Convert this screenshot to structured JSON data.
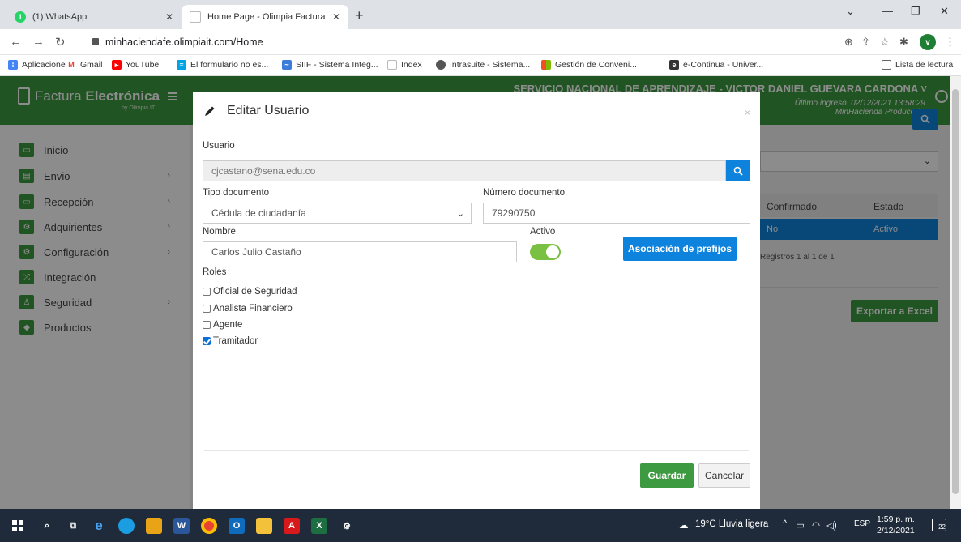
{
  "browser": {
    "tabs": [
      {
        "title": "(1) WhatsApp",
        "active": false
      },
      {
        "title": "Home Page - Olimpia Factura Ele",
        "active": true
      }
    ],
    "url": "minhaciendafe.olimpiait.com/Home",
    "profile_initial": "v",
    "bookmarks": [
      {
        "label": "Aplicaciones",
        "icon": "apps-grid-icon"
      },
      {
        "label": "Gmail",
        "icon": "gmail-icon"
      },
      {
        "label": "YouTube",
        "icon": "youtube-icon"
      },
      {
        "label": "El formulario no es...",
        "icon": "form-icon"
      },
      {
        "label": "SIIF - Sistema Integ...",
        "icon": "siif-icon"
      },
      {
        "label": "Index",
        "icon": "page-icon"
      },
      {
        "label": "Intrasuite - Sistema...",
        "icon": "globe-icon"
      },
      {
        "label": "Gestión de Conveni...",
        "icon": "windows-logo-icon"
      },
      {
        "label": "e-Continua - Univer...",
        "icon": "econtinua-icon"
      }
    ],
    "reading_list": "Lista de lectura"
  },
  "app": {
    "logo_text_light": "Factura ",
    "logo_text_bold": "Electrónica",
    "logo_sub": "by Olimpia IT",
    "org_user": "SERVICIO NACIONAL DE APRENDIZAJE - VICTOR DANIEL GUEVARA CARDONA ˅",
    "last_login": "Último ingreso: 02/12/2021 13:58:29",
    "environment": "MinHacienda Producción",
    "sidebar": [
      {
        "label": "Inicio",
        "has_children": false
      },
      {
        "label": "Envio",
        "has_children": true
      },
      {
        "label": "Recepción",
        "has_children": true
      },
      {
        "label": "Adquirientes",
        "has_children": true
      },
      {
        "label": "Configuración",
        "has_children": true
      },
      {
        "label": "Integración",
        "has_children": false
      },
      {
        "label": "Seguridad",
        "has_children": true
      },
      {
        "label": "Productos",
        "has_children": false
      }
    ],
    "background_table": {
      "headers": [
        "Confirmado",
        "Estado"
      ],
      "row": [
        "No",
        "Activo"
      ],
      "records": "Registros 1 al 1 de 1",
      "export_label": "Exportar a Excel"
    }
  },
  "modal": {
    "title": "Editar Usuario",
    "close": "×",
    "usuario_label": "Usuario",
    "usuario_value": "cjcastano@sena.edu.co",
    "tipo_doc_label": "Tipo documento",
    "tipo_doc_value": "Cédula de ciudadanía",
    "num_doc_label": "Número documento",
    "num_doc_value": "79290750",
    "nombre_label": "Nombre",
    "nombre_value": "Carlos Julio Castaño",
    "activo_label": "Activo",
    "activo_value": true,
    "prefix_button": "Asociación de prefijos",
    "roles_label": "Roles",
    "roles": [
      {
        "label": "Oficial de Seguridad",
        "checked": false
      },
      {
        "label": "Analista Financiero",
        "checked": false
      },
      {
        "label": "Agente",
        "checked": false
      },
      {
        "label": "Tramitador",
        "checked": true
      }
    ],
    "save_label": "Guardar",
    "cancel_label": "Cancelar"
  },
  "taskbar": {
    "weather": "19°C  Lluvia ligera",
    "lang": "ESP",
    "time": "1:59 p. m.",
    "date": "2/12/2021",
    "notifications": "22"
  },
  "colors": {
    "brand_green": "#3d9a40",
    "primary_blue": "#0d83dd",
    "toggle_green": "#7ac143"
  }
}
